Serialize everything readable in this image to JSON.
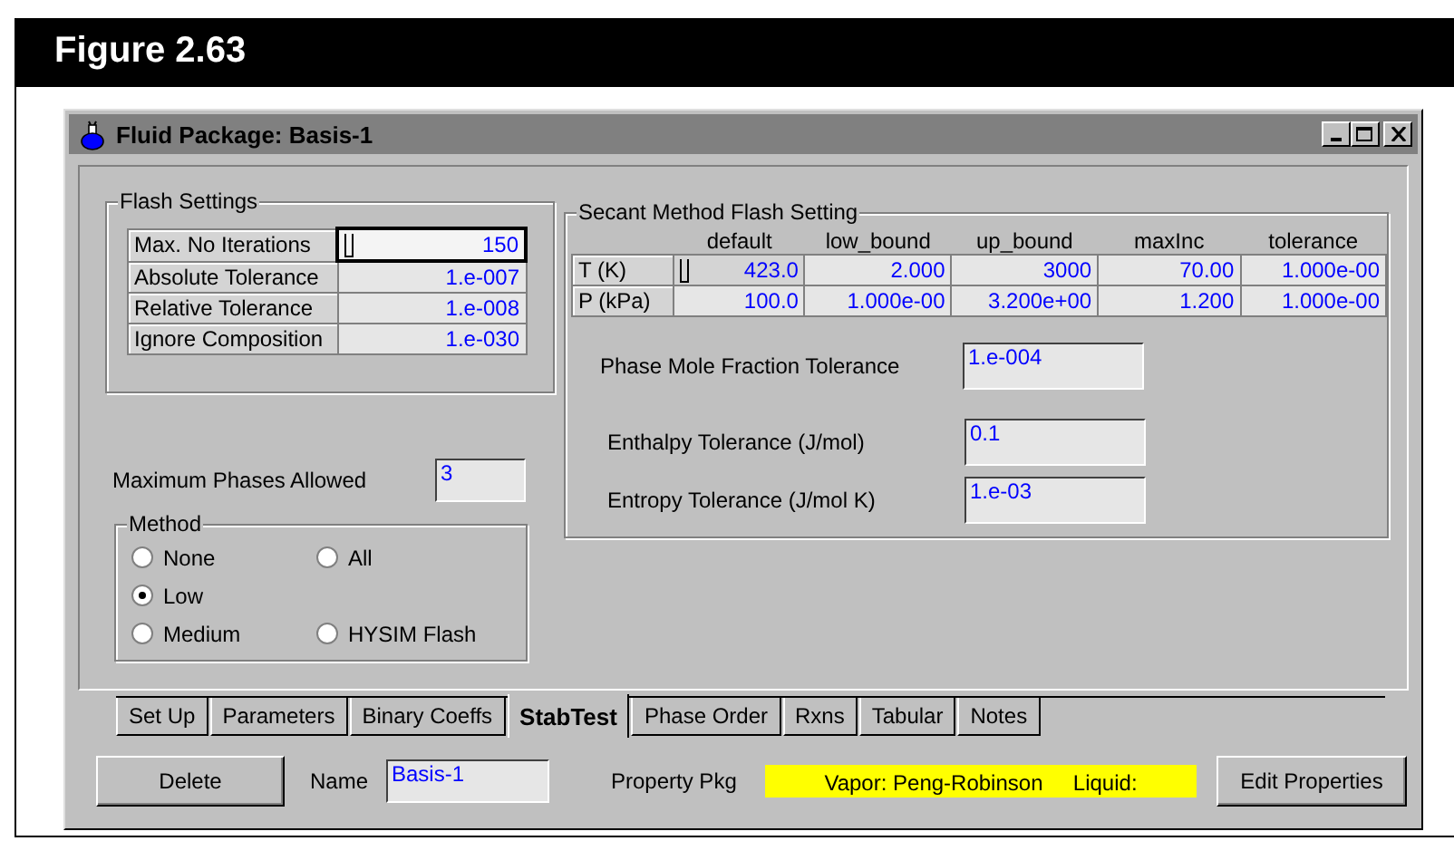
{
  "figure": {
    "title": "Figure 2.63"
  },
  "window": {
    "title": "Fluid Package: Basis-1"
  },
  "flash_settings": {
    "title": "Flash Settings",
    "rows": [
      {
        "label": "Max. No Iterations",
        "value": "150",
        "selected": true
      },
      {
        "label": "Absolute Tolerance",
        "value": "1.e-007",
        "selected": false
      },
      {
        "label": "Relative Tolerance",
        "value": "1.e-008",
        "selected": false
      },
      {
        "label": "Ignore Composition",
        "value": "1.e-030",
        "selected": false
      }
    ]
  },
  "max_phases": {
    "label": "Maximum Phases Allowed",
    "value": "3"
  },
  "method": {
    "title": "Method",
    "options": [
      {
        "label": "None",
        "selected": false
      },
      {
        "label": "All",
        "selected": false
      },
      {
        "label": "Low",
        "selected": true
      },
      {
        "label": "Medium",
        "selected": false
      },
      {
        "label": "HYSIM Flash",
        "selected": false
      }
    ]
  },
  "secant": {
    "title": "Secant Method Flash Setting",
    "columns": [
      "default",
      "low_bound",
      "up_bound",
      "maxInc",
      "tolerance"
    ],
    "rows": [
      {
        "label": "T (K)",
        "values": [
          "423.0",
          "2.000",
          "3000",
          "70.00",
          "1.000e-00"
        ],
        "selected": true
      },
      {
        "label": "P (kPa)",
        "values": [
          "100.0",
          "1.000e-00",
          "3.200e+00",
          "1.200",
          "1.000e-00"
        ],
        "selected": false
      }
    ],
    "tolerances": [
      {
        "label": "Phase Mole Fraction Tolerance",
        "value": "1.e-004"
      },
      {
        "label": "Enthalpy Tolerance (J/mol)",
        "value": "0.1"
      },
      {
        "label": "Entropy Tolerance (J/mol K)",
        "value": "1.e-03"
      }
    ]
  },
  "tabs": [
    {
      "label": "Set Up",
      "selected": false
    },
    {
      "label": "Parameters",
      "selected": false
    },
    {
      "label": "Binary Coeffs",
      "selected": false
    },
    {
      "label": "StabTest",
      "selected": true
    },
    {
      "label": "Phase Order",
      "selected": false
    },
    {
      "label": "Rxns",
      "selected": false
    },
    {
      "label": "Tabular",
      "selected": false
    },
    {
      "label": "Notes",
      "selected": false
    }
  ],
  "footer": {
    "delete_button": "Delete",
    "name_label": "Name",
    "name_value": "Basis-1",
    "property_label": "Property Pkg",
    "property_value": "Vapor: Peng-Robinson     Liquid:",
    "edit_button": "Edit Properties"
  }
}
